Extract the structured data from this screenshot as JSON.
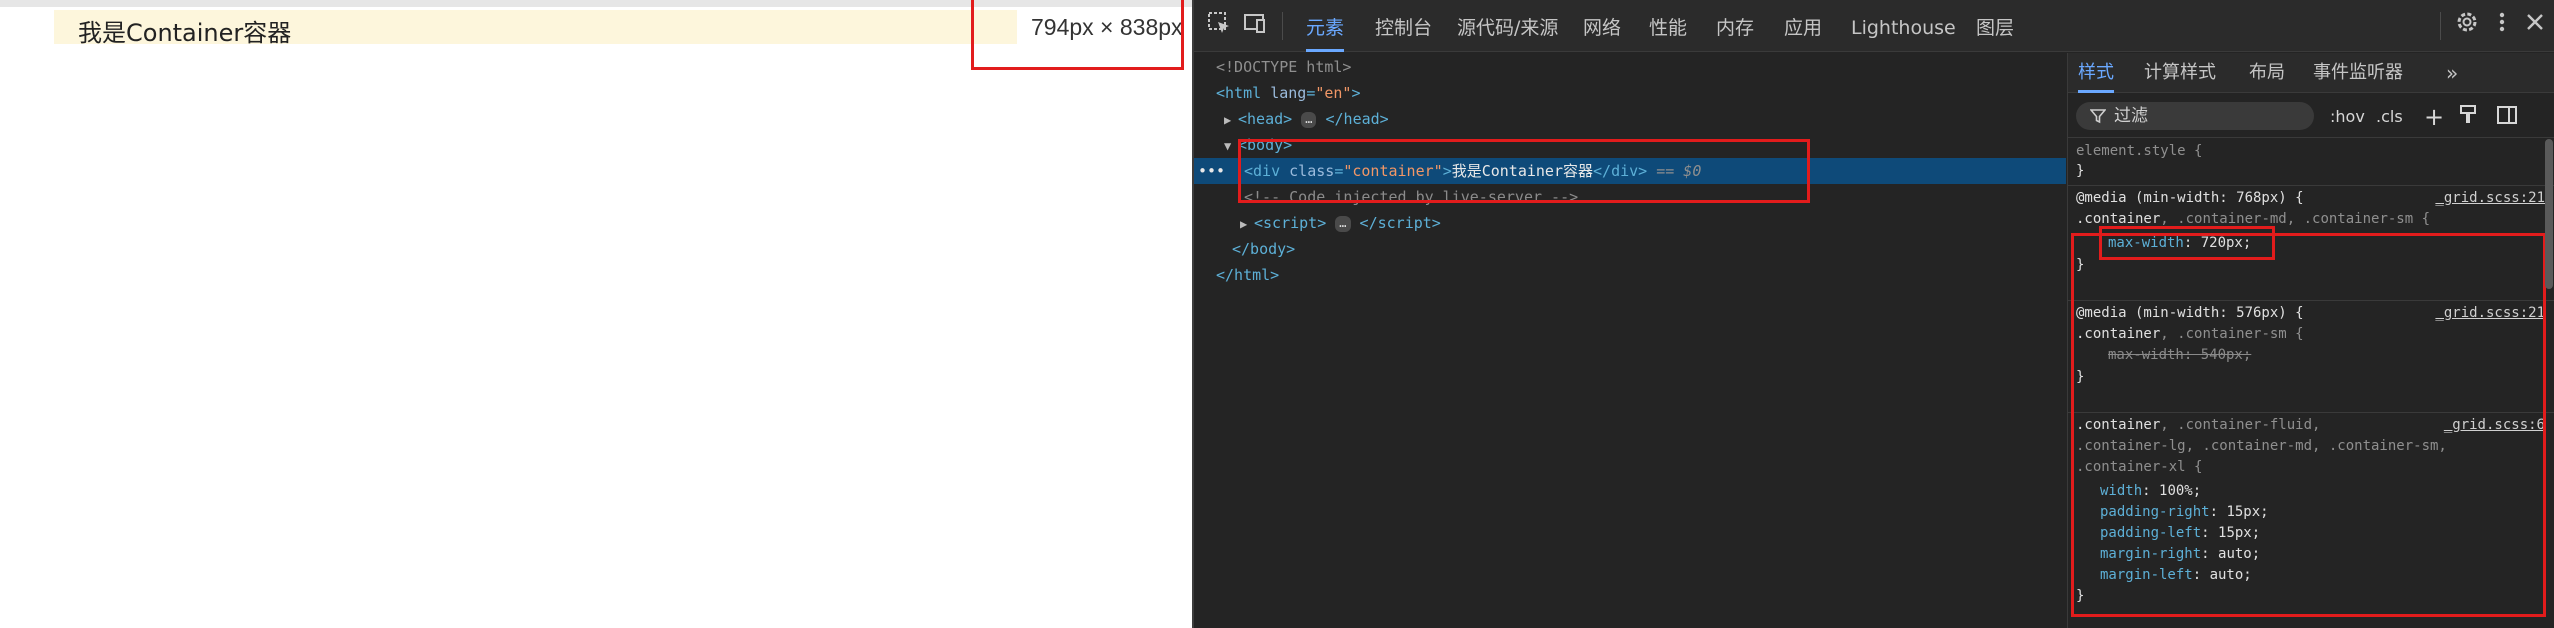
{
  "page": {
    "container_text": "我是Container容器",
    "size_badge": "794px × 838px"
  },
  "devtools": {
    "tabs": [
      "元素",
      "控制台",
      "源代码/来源",
      "网络",
      "性能",
      "内存",
      "应用",
      "Lighthouse",
      "图层"
    ],
    "active_tab": "元素",
    "icons": [
      "inspect-element-icon",
      "device-toolbar-icon",
      "settings-gear-icon",
      "more-vertical-icon",
      "close-icon"
    ],
    "dom": {
      "doctype": "<!DOCTYPE html>",
      "html_open_tag": "html",
      "html_attr_name": "lang",
      "html_attr_value": "\"en\"",
      "head_tag": "head",
      "body_tag": "body",
      "div_tag": "div",
      "div_attr_name": "class",
      "div_attr_value": "\"container\"",
      "div_text": "我是Container容器",
      "selected_marker": "== $0",
      "comment": "<!-- Code injected by live-server -->",
      "script_tag": "script",
      "body_close": "</body>",
      "html_close": "</html>",
      "ellipsis": "…"
    },
    "styles_tabs": [
      "样式",
      "计算样式",
      "布局",
      "事件监听器"
    ],
    "styles_active_tab": "样式",
    "filter_placeholder": "过滤",
    "filter_buttons": [
      ":hov",
      ".cls",
      "+"
    ],
    "rules": {
      "element_style": "element.style {",
      "close_brace": "}",
      "r1_media": "@media (min-width: 768px) {",
      "r1_selector_main": ".container",
      "r1_selector_rest": ", .container-md, .container-sm {",
      "r1_prop": "max-width",
      "r1_value": "720px;",
      "r1_source": "_grid.scss:21",
      "r2_media": "@media (min-width: 576px) {",
      "r2_selector_main": ".container",
      "r2_selector_rest": ", .container-sm {",
      "r2_prop_line": "max-width: 540px;",
      "r2_source": "_grid.scss:21",
      "r3_selector_main": ".container",
      "r3_selector_line1_rest": ", .container-fluid,",
      "r3_selector_line2": ".container-lg, .container-md, .container-sm,",
      "r3_selector_line3": ".container-xl {",
      "r3_source": "_grid.scss:6",
      "r3_props": [
        {
          "name": "width",
          "value": "100%;"
        },
        {
          "name": "padding-right",
          "value": "15px;"
        },
        {
          "name": "padding-left",
          "value": "15px;"
        },
        {
          "name": "margin-right",
          "value": "auto;"
        },
        {
          "name": "margin-left",
          "value": "auto;"
        }
      ]
    }
  },
  "colors": {
    "highlight_red": "#e21c1c",
    "selected_row": "#0e4a79",
    "accent_blue": "#6aa8ff",
    "container_bg": "#fdf6dc"
  }
}
